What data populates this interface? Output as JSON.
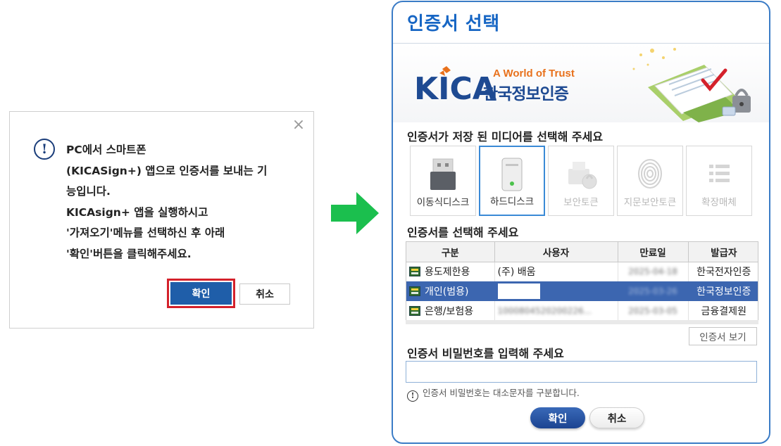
{
  "mini_dialog": {
    "message_lines": [
      "PC에서 스마트폰",
      "(KICASign+) 앱으로 인증서를 보내는 기",
      "능입니다.",
      "KICAsign+ 앱을 실행하시고",
      "'가져오기'메뉴를 선택하신 후 아래",
      "'확인'버튼을 클릭해주세요."
    ],
    "ok_label": "확인",
    "cancel_label": "취소",
    "close_glyph": "×",
    "info_glyph": "!"
  },
  "main_dialog": {
    "title": "인증서 선택",
    "brand": {
      "logo_text": "KICA",
      "tagline": "A World of Trust",
      "korean_name": "한국정보인증"
    },
    "media_prompt": "인증서가 저장 된 미디어를 선택해 주세요",
    "media": [
      {
        "label": "이동식디스크",
        "state": "enabled"
      },
      {
        "label": "하드디스크",
        "state": "selected"
      },
      {
        "label": "보안토큰",
        "state": "disabled"
      },
      {
        "label": "지문보안토큰",
        "state": "disabled"
      },
      {
        "label": "확장매체",
        "state": "disabled"
      }
    ],
    "cert_prompt": "인증서를 선택해 주세요",
    "table": {
      "headers": [
        "구분",
        "사용자",
        "만료일",
        "발급자"
      ],
      "rows": [
        {
          "type": "용도제한용",
          "user": "(주) 배움",
          "expiry": "2025-04-18",
          "issuer": "한국전자인증",
          "selected": false
        },
        {
          "type": "개인(범용)",
          "user": "",
          "expiry": "2025-03-26",
          "issuer": "한국정보인증",
          "selected": true
        },
        {
          "type": "은행/보험용",
          "user": "1000804520200226...",
          "expiry": "2025-03-05",
          "issuer": "금융결제원",
          "selected": false
        }
      ]
    },
    "view_cert_label": "인증서 보기",
    "password_prompt": "인증서 비밀번호를 입력해 주세요",
    "password_value": "",
    "password_hint": "인증서 비밀번호는 대소문자를 구분합니다.",
    "hint_glyph": "!",
    "ok_label": "확인",
    "cancel_label": "취소"
  },
  "colors": {
    "accent_blue": "#1766c4",
    "selected_row": "#3c66b0",
    "highlight_red": "#d4212b",
    "arrow_green": "#1bbf4e",
    "brand_orange": "#e8711c",
    "brand_navy": "#1e4a92"
  }
}
